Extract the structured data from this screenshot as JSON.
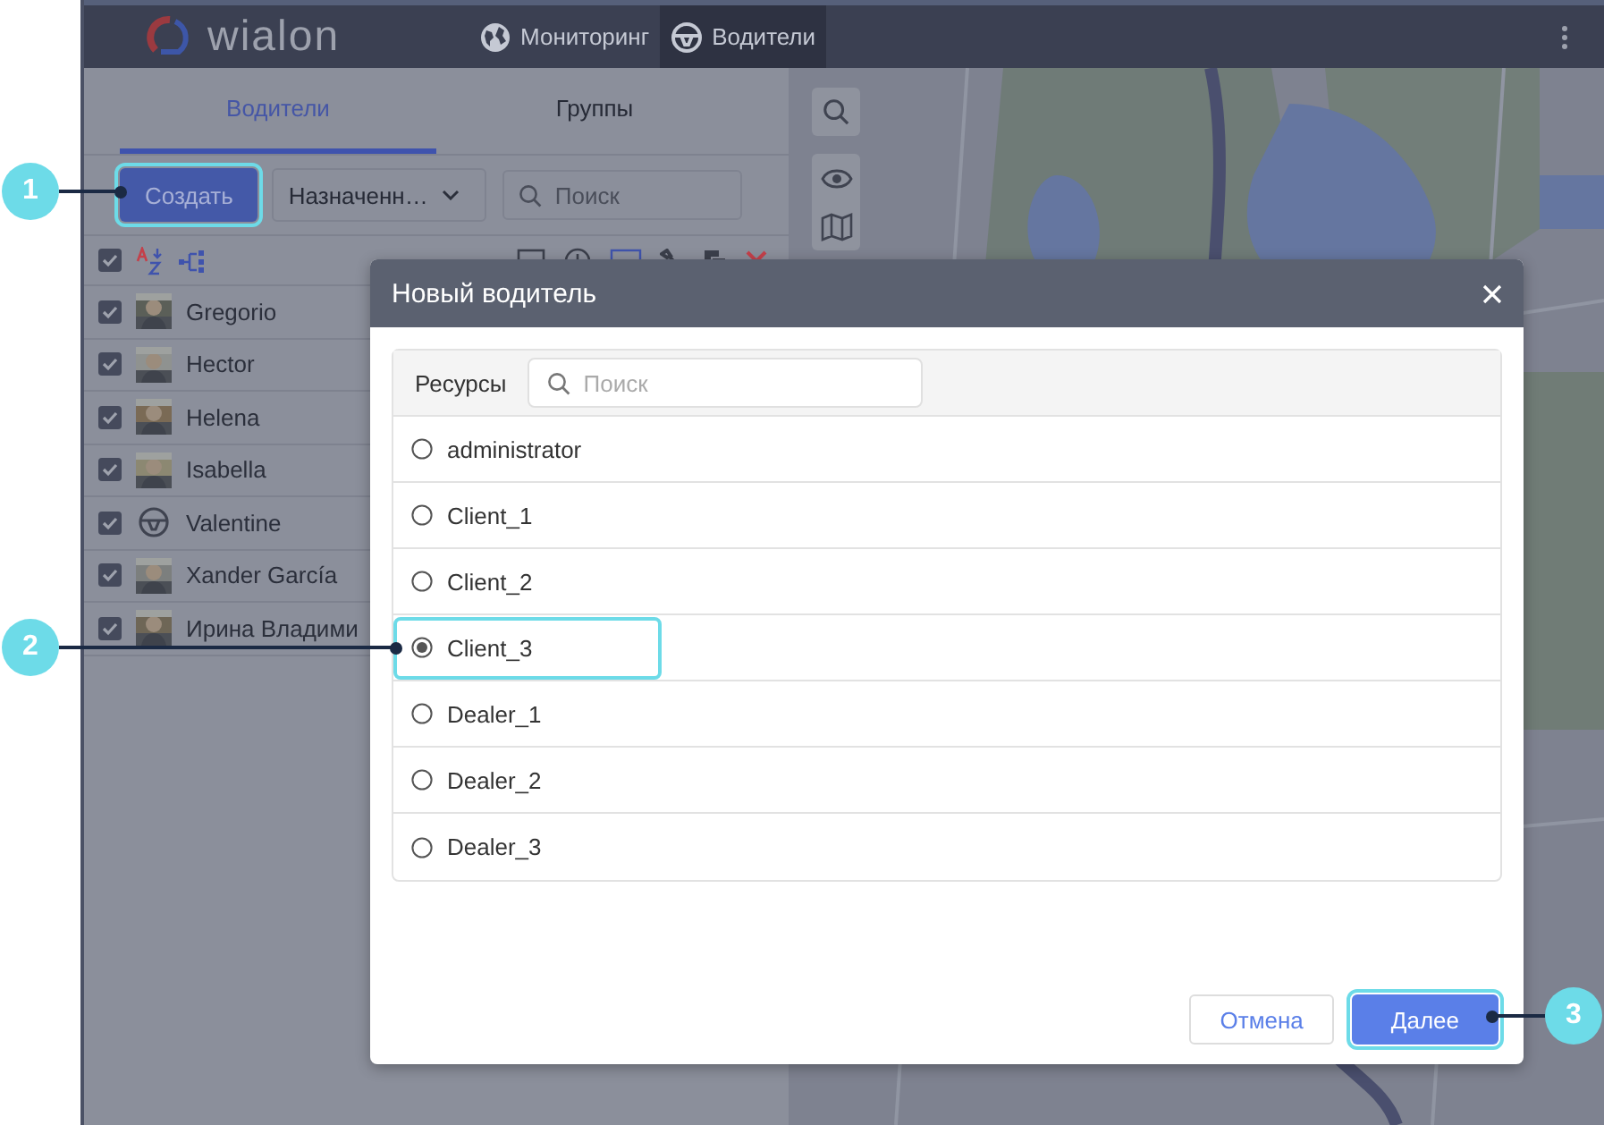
{
  "header": {
    "logo": "wialon",
    "nav": [
      {
        "label": "Мониторинг",
        "selected": false
      },
      {
        "label": "Водители",
        "selected": true
      }
    ]
  },
  "sidebar": {
    "tabs": [
      {
        "label": "Водители",
        "selected": true
      },
      {
        "label": "Группы",
        "selected": false
      }
    ],
    "create_button": {
      "label": "Создать",
      "highlighted": true
    },
    "filter_dropdown": {
      "value": "Назначенн…"
    },
    "search": {
      "placeholder": "Поиск"
    },
    "select_all": {
      "checked": true
    },
    "drivers": [
      {
        "name": "Gregorio",
        "checked": true
      },
      {
        "name": "Hector",
        "checked": true
      },
      {
        "name": "Helena",
        "checked": true
      },
      {
        "name": "Isabella",
        "checked": true
      },
      {
        "name": "Valentine",
        "checked": true,
        "kind": "icon"
      },
      {
        "name": "Xander García",
        "checked": true
      },
      {
        "name": "Ирина Владими",
        "checked": true
      }
    ]
  },
  "dialog": {
    "title": "Новый водитель",
    "resources_label": "Ресурсы",
    "search": {
      "placeholder": "Поиск"
    },
    "resources": [
      {
        "name": "administrator",
        "selected": false,
        "highlighted": false
      },
      {
        "name": "Client_1",
        "selected": false,
        "highlighted": false
      },
      {
        "name": "Client_2",
        "selected": false,
        "highlighted": false
      },
      {
        "name": "Client_3",
        "selected": true,
        "highlighted": true
      },
      {
        "name": "Dealer_1",
        "selected": false,
        "highlighted": false
      },
      {
        "name": "Dealer_2",
        "selected": false,
        "highlighted": false
      },
      {
        "name": "Dealer_3",
        "selected": false,
        "highlighted": false
      }
    ],
    "buttons": [
      {
        "label": "Отмена",
        "kind": "secondary",
        "highlighted": false
      },
      {
        "label": "Далее",
        "kind": "primary",
        "highlighted": true
      }
    ]
  },
  "callouts": [
    {
      "number": "1"
    },
    {
      "number": "2"
    },
    {
      "number": "3"
    }
  ]
}
